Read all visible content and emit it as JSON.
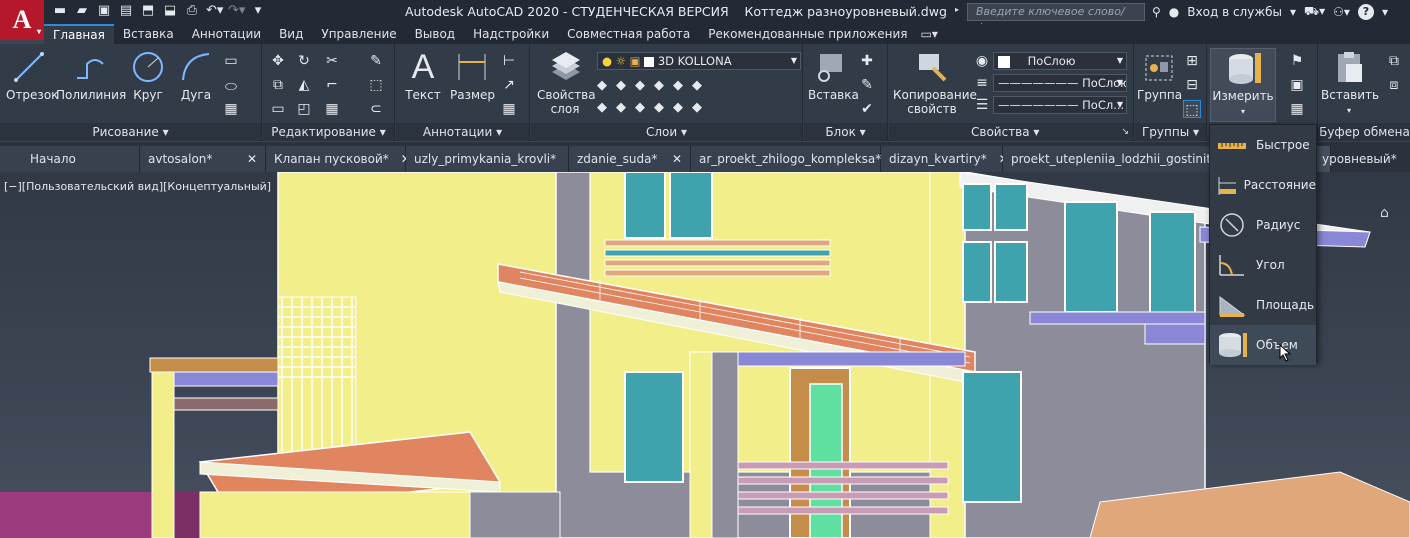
{
  "app": {
    "logo_letter": "A",
    "title": "Autodesk AutoCAD 2020 - СТУДЕНЧЕСКАЯ ВЕРСИЯ    Коттедж разноуровневый.dwg",
    "search_placeholder": "Введите ключевое слово/фразу",
    "signin_label": "Вход в службы",
    "help_icon": "?"
  },
  "ribbon_tabs": [
    "Главная",
    "Вставка",
    "Аннотации",
    "Вид",
    "Управление",
    "Вывод",
    "Надстройки",
    "Совместная работа",
    "Рекомендованные приложения"
  ],
  "panels": {
    "draw": {
      "title": "Рисование",
      "line": "Отрезок",
      "polyline": "Полилиния",
      "circle": "Круг",
      "arc": "Дуга"
    },
    "modify": {
      "title": "Редактирование"
    },
    "annotation": {
      "title": "Аннотации",
      "text": "Текст",
      "dimension": "Размер"
    },
    "layers": {
      "title": "Слои",
      "properties_line1": "Свойства",
      "properties_line2": "слоя",
      "current_layer": "3D KOLLONA"
    },
    "block": {
      "title": "Блок",
      "insert": "Вставка"
    },
    "properties": {
      "title": "Свойства",
      "match_line1": "Копирование",
      "match_line2": "свойств",
      "color": "ПоСлою",
      "linetype": "ПоСлою",
      "lineweight": "ПоСл..."
    },
    "groups": {
      "title": "Группы",
      "group": "Группа"
    },
    "utilities": {
      "measure": "Измерить"
    },
    "clipboard": {
      "title": "Буфер обмена",
      "paste": "Вставить"
    }
  },
  "file_tabs": [
    {
      "label": "Начало",
      "closable": false
    },
    {
      "label": "avtosalon*",
      "closable": true
    },
    {
      "label": "Клапан пусковой*",
      "closable": true
    },
    {
      "label": "uzly_primykania_krovli*",
      "closable": true
    },
    {
      "label": "zdanie_suda*",
      "closable": true
    },
    {
      "label": "ar_proekt_zhilogo_kompleksa*",
      "closable": true
    },
    {
      "label": "dizayn_kvartiry*",
      "closable": true
    },
    {
      "label": "proekt_utepleniia_lodzhii_gostinitsy*",
      "closable": true
    },
    {
      "label": "уровневый*",
      "closable": true
    }
  ],
  "viewport": {
    "label": "[−][Пользовательский вид][Концептуальный]"
  },
  "measure_menu": [
    {
      "label": "Быстрое",
      "icon": "ruler-quick-icon"
    },
    {
      "label": "Расстояние",
      "icon": "ruler-distance-icon"
    },
    {
      "label": "Радиус",
      "icon": "radius-icon"
    },
    {
      "label": "Угол",
      "icon": "angle-icon"
    },
    {
      "label": "Площадь",
      "icon": "area-icon"
    },
    {
      "label": "Объем",
      "icon": "volume-icon",
      "highlighted": true
    }
  ],
  "colors": {
    "accent": "#2d8ad6",
    "logo": "#b5182a",
    "wall_yellow": "#f2ef8a",
    "window": "#3fa3ad",
    "roof": "#e0855f"
  }
}
